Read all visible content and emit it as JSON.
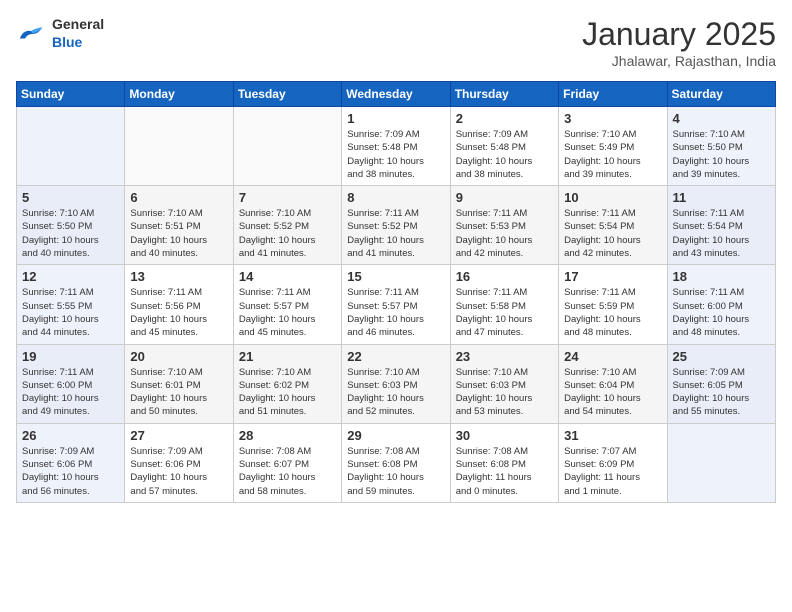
{
  "logo": {
    "general": "General",
    "blue": "Blue"
  },
  "title": "January 2025",
  "location": "Jhalawar, Rajasthan, India",
  "weekdays": [
    "Sunday",
    "Monday",
    "Tuesday",
    "Wednesday",
    "Thursday",
    "Friday",
    "Saturday"
  ],
  "weeks": [
    [
      {
        "day": "",
        "info": ""
      },
      {
        "day": "",
        "info": ""
      },
      {
        "day": "",
        "info": ""
      },
      {
        "day": "1",
        "info": "Sunrise: 7:09 AM\nSunset: 5:48 PM\nDaylight: 10 hours\nand 38 minutes."
      },
      {
        "day": "2",
        "info": "Sunrise: 7:09 AM\nSunset: 5:48 PM\nDaylight: 10 hours\nand 38 minutes."
      },
      {
        "day": "3",
        "info": "Sunrise: 7:10 AM\nSunset: 5:49 PM\nDaylight: 10 hours\nand 39 minutes."
      },
      {
        "day": "4",
        "info": "Sunrise: 7:10 AM\nSunset: 5:50 PM\nDaylight: 10 hours\nand 39 minutes."
      }
    ],
    [
      {
        "day": "5",
        "info": "Sunrise: 7:10 AM\nSunset: 5:50 PM\nDaylight: 10 hours\nand 40 minutes."
      },
      {
        "day": "6",
        "info": "Sunrise: 7:10 AM\nSunset: 5:51 PM\nDaylight: 10 hours\nand 40 minutes."
      },
      {
        "day": "7",
        "info": "Sunrise: 7:10 AM\nSunset: 5:52 PM\nDaylight: 10 hours\nand 41 minutes."
      },
      {
        "day": "8",
        "info": "Sunrise: 7:11 AM\nSunset: 5:52 PM\nDaylight: 10 hours\nand 41 minutes."
      },
      {
        "day": "9",
        "info": "Sunrise: 7:11 AM\nSunset: 5:53 PM\nDaylight: 10 hours\nand 42 minutes."
      },
      {
        "day": "10",
        "info": "Sunrise: 7:11 AM\nSunset: 5:54 PM\nDaylight: 10 hours\nand 42 minutes."
      },
      {
        "day": "11",
        "info": "Sunrise: 7:11 AM\nSunset: 5:54 PM\nDaylight: 10 hours\nand 43 minutes."
      }
    ],
    [
      {
        "day": "12",
        "info": "Sunrise: 7:11 AM\nSunset: 5:55 PM\nDaylight: 10 hours\nand 44 minutes."
      },
      {
        "day": "13",
        "info": "Sunrise: 7:11 AM\nSunset: 5:56 PM\nDaylight: 10 hours\nand 45 minutes."
      },
      {
        "day": "14",
        "info": "Sunrise: 7:11 AM\nSunset: 5:57 PM\nDaylight: 10 hours\nand 45 minutes."
      },
      {
        "day": "15",
        "info": "Sunrise: 7:11 AM\nSunset: 5:57 PM\nDaylight: 10 hours\nand 46 minutes."
      },
      {
        "day": "16",
        "info": "Sunrise: 7:11 AM\nSunset: 5:58 PM\nDaylight: 10 hours\nand 47 minutes."
      },
      {
        "day": "17",
        "info": "Sunrise: 7:11 AM\nSunset: 5:59 PM\nDaylight: 10 hours\nand 48 minutes."
      },
      {
        "day": "18",
        "info": "Sunrise: 7:11 AM\nSunset: 6:00 PM\nDaylight: 10 hours\nand 48 minutes."
      }
    ],
    [
      {
        "day": "19",
        "info": "Sunrise: 7:11 AM\nSunset: 6:00 PM\nDaylight: 10 hours\nand 49 minutes."
      },
      {
        "day": "20",
        "info": "Sunrise: 7:10 AM\nSunset: 6:01 PM\nDaylight: 10 hours\nand 50 minutes."
      },
      {
        "day": "21",
        "info": "Sunrise: 7:10 AM\nSunset: 6:02 PM\nDaylight: 10 hours\nand 51 minutes."
      },
      {
        "day": "22",
        "info": "Sunrise: 7:10 AM\nSunset: 6:03 PM\nDaylight: 10 hours\nand 52 minutes."
      },
      {
        "day": "23",
        "info": "Sunrise: 7:10 AM\nSunset: 6:03 PM\nDaylight: 10 hours\nand 53 minutes."
      },
      {
        "day": "24",
        "info": "Sunrise: 7:10 AM\nSunset: 6:04 PM\nDaylight: 10 hours\nand 54 minutes."
      },
      {
        "day": "25",
        "info": "Sunrise: 7:09 AM\nSunset: 6:05 PM\nDaylight: 10 hours\nand 55 minutes."
      }
    ],
    [
      {
        "day": "26",
        "info": "Sunrise: 7:09 AM\nSunset: 6:06 PM\nDaylight: 10 hours\nand 56 minutes."
      },
      {
        "day": "27",
        "info": "Sunrise: 7:09 AM\nSunset: 6:06 PM\nDaylight: 10 hours\nand 57 minutes."
      },
      {
        "day": "28",
        "info": "Sunrise: 7:08 AM\nSunset: 6:07 PM\nDaylight: 10 hours\nand 58 minutes."
      },
      {
        "day": "29",
        "info": "Sunrise: 7:08 AM\nSunset: 6:08 PM\nDaylight: 10 hours\nand 59 minutes."
      },
      {
        "day": "30",
        "info": "Sunrise: 7:08 AM\nSunset: 6:08 PM\nDaylight: 11 hours\nand 0 minutes."
      },
      {
        "day": "31",
        "info": "Sunrise: 7:07 AM\nSunset: 6:09 PM\nDaylight: 11 hours\nand 1 minute."
      },
      {
        "day": "",
        "info": ""
      }
    ]
  ]
}
